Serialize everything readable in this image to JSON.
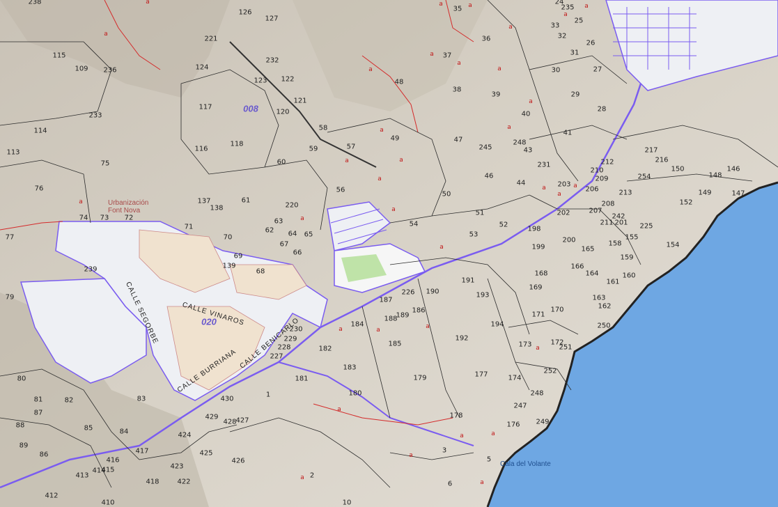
{
  "map": {
    "colors": {
      "terrain": "#d9d4cb",
      "sea": "#6ea7e3",
      "parcel_line": "#2a2a2a",
      "contour_line": "#d42a2a",
      "boundary_line": "#7a5cf0",
      "urban_fill": "#f0e2cf",
      "paved_fill": "#eef0f4",
      "green_fill": "#bfe3a8"
    },
    "zones": [
      "008",
      "020"
    ],
    "place_name": "Urbanización Font Nova",
    "cove_name": "Cala del Volante",
    "streets": [
      "CALLE VINAROS",
      "CALLE SEGORBE",
      "CALLE BURRIANA",
      "CALLE BENICARLO"
    ],
    "parcels": [
      "238",
      "126",
      "127",
      "35",
      "35b",
      "235",
      "24",
      "33",
      "25",
      "115",
      "109",
      "236",
      "221",
      "232",
      "36",
      "32",
      "31",
      "26",
      "124",
      "122",
      "37",
      "30",
      "27",
      "123",
      "48",
      "121",
      "38",
      "39",
      "29",
      "117",
      "120",
      "40",
      "28",
      "233",
      "114",
      "58",
      "57",
      "49",
      "47",
      "248",
      "42",
      "41",
      "113",
      "116",
      "118",
      "59",
      "245",
      "43",
      "217",
      "216",
      "150",
      "75",
      "60",
      "231",
      "46",
      "44",
      "212",
      "210",
      "209",
      "203",
      "254",
      "148",
      "146",
      "76",
      "56",
      "50",
      "206",
      "213",
      "149",
      "147",
      "137",
      "138",
      "61",
      "220",
      "54",
      "51",
      "52",
      "208",
      "202",
      "207",
      "211",
      "201",
      "242",
      "225",
      "152",
      "74",
      "73",
      "72",
      "63",
      "64",
      "65",
      "71",
      "62",
      "67",
      "66",
      "53",
      "198",
      "200",
      "155",
      "154",
      "77",
      "70",
      "69",
      "199",
      "158",
      "166",
      "165",
      "164",
      "159",
      "239",
      "139",
      "68",
      "191",
      "168",
      "163",
      "161",
      "160",
      "187",
      "226",
      "190",
      "169",
      "162",
      "79",
      "188",
      "189",
      "186",
      "193",
      "171",
      "170",
      "184",
      "230",
      "229",
      "194",
      "250",
      "228",
      "182",
      "192",
      "173",
      "172",
      "251",
      "227",
      "185",
      "80",
      "183",
      "179",
      "177",
      "174",
      "252",
      "181",
      "82",
      "81",
      "180",
      "248b",
      "83",
      "430",
      "1",
      "247",
      "178",
      "176",
      "249",
      "88",
      "87",
      "85",
      "84",
      "429",
      "428",
      "427",
      "89",
      "86",
      "417",
      "424",
      "425",
      "426",
      "416",
      "415",
      "3",
      "413",
      "414",
      "423",
      "418",
      "422",
      "2",
      "6",
      "5",
      "412",
      "410",
      "10"
    ]
  }
}
